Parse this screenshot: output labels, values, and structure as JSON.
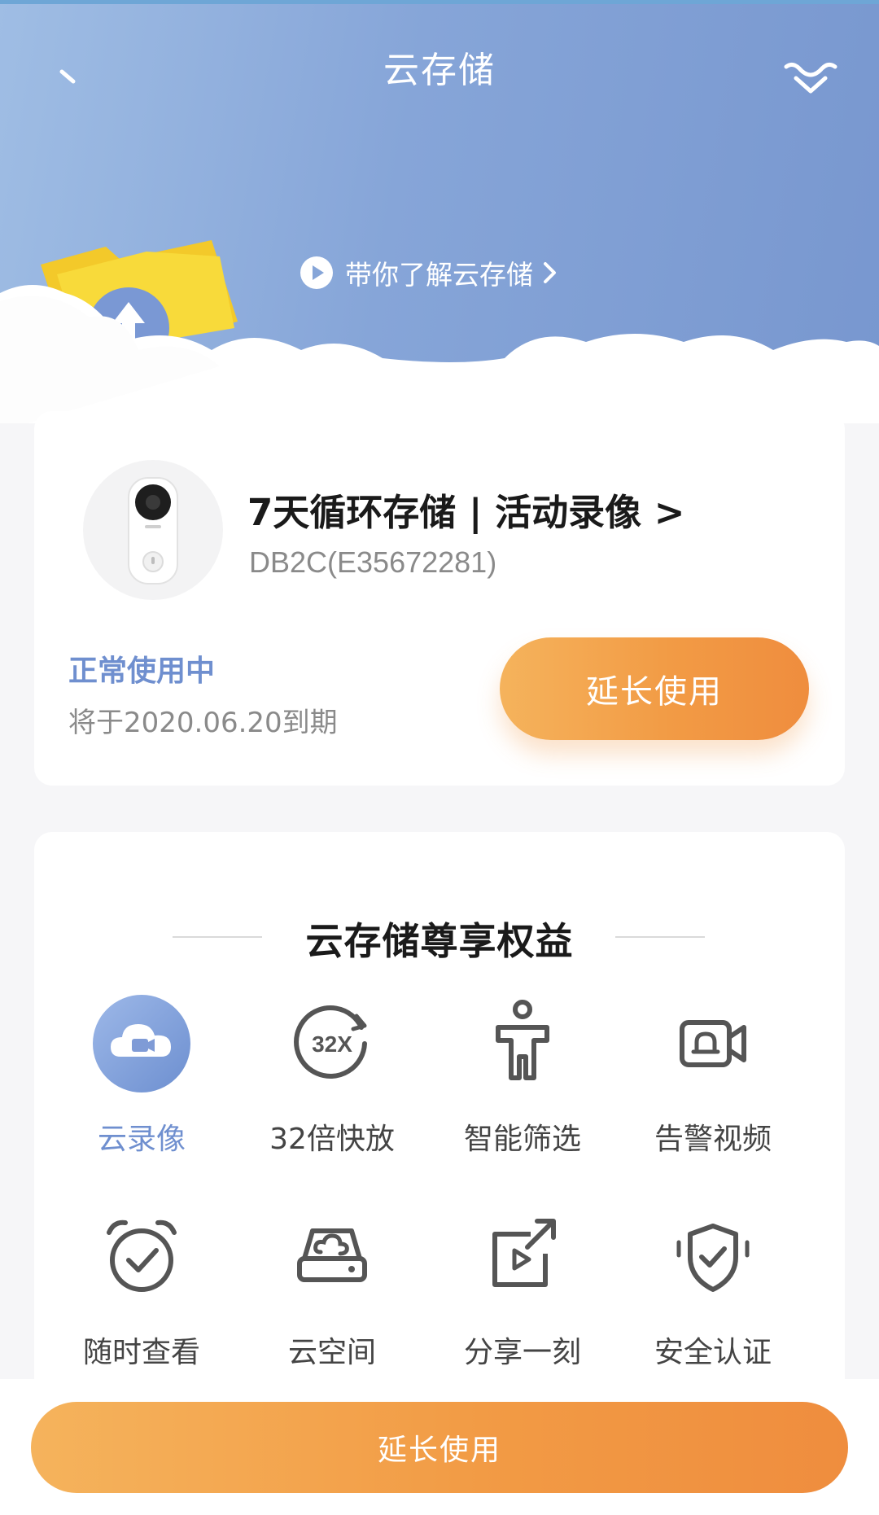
{
  "header": {
    "title": "云存储",
    "learn_link": "带你了解云存储",
    "back_icon": "back-arrow-icon",
    "menu_icon": "more-menu-icon"
  },
  "plan": {
    "title": "7天循环存储 | 活动录像 >",
    "device_id": "DB2C(E35672281)",
    "status": "正常使用中",
    "expiry": "将于2020.06.20到期",
    "extend_label": "延长使用"
  },
  "benefits": {
    "title": "云存储尊享权益",
    "items": [
      {
        "label": "云录像",
        "icon": "cloud-video-icon",
        "active": true
      },
      {
        "label": "32倍快放",
        "icon": "fast-play-32x-icon",
        "badge": "32X"
      },
      {
        "label": "智能筛选",
        "icon": "person-filter-icon"
      },
      {
        "label": "告警视频",
        "icon": "alarm-video-icon"
      },
      {
        "label": "随时查看",
        "icon": "alarm-clock-icon"
      },
      {
        "label": "云空间",
        "icon": "cloud-drive-icon"
      },
      {
        "label": "分享一刻",
        "icon": "share-video-icon"
      },
      {
        "label": "安全认证",
        "icon": "security-shield-icon"
      }
    ]
  },
  "bottom": {
    "extend_label": "延长使用"
  },
  "colors": {
    "accent_blue": "#6f8fcf",
    "button_orange": "#f29b45",
    "header_gradient_start": "#9fbde4",
    "header_gradient_end": "#7897cf"
  }
}
